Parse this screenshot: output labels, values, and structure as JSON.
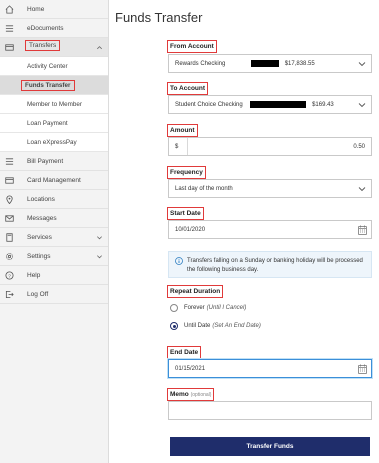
{
  "sidebar": {
    "items": [
      {
        "label": "Home",
        "icon": "home-icon"
      },
      {
        "label": "eDocuments",
        "icon": "menu-lines-icon"
      },
      {
        "label": "Transfers",
        "icon": "transfer-card-icon"
      },
      {
        "label": "Bill Payment",
        "icon": "menu-lines-icon"
      },
      {
        "label": "Card Management",
        "icon": "card-icon"
      },
      {
        "label": "Locations",
        "icon": "location-pin-icon"
      },
      {
        "label": "Messages",
        "icon": "envelope-icon"
      },
      {
        "label": "Services",
        "icon": "calculator-icon"
      },
      {
        "label": "Settings",
        "icon": "gear-icon"
      },
      {
        "label": "Help",
        "icon": "help-icon"
      },
      {
        "label": "Log Off",
        "icon": "logout-icon"
      }
    ],
    "transfers_sub": [
      {
        "label": "Activity Center"
      },
      {
        "label": "Funds Transfer"
      },
      {
        "label": "Member to Member"
      },
      {
        "label": "Loan Payment"
      },
      {
        "label": "Loan eXpressPay"
      }
    ]
  },
  "main": {
    "title": "Funds Transfer",
    "from_account": {
      "label": "From Account",
      "name": "Rewards Checking",
      "balance": "$17,838.55"
    },
    "to_account": {
      "label": "To Account",
      "name": "Student Choice Checking",
      "balance": "$169.43"
    },
    "amount": {
      "label": "Amount",
      "prefix": "$",
      "value": "0.50"
    },
    "frequency": {
      "label": "Frequency",
      "value": "Last day of the month"
    },
    "start_date": {
      "label": "Start Date",
      "value": "10/01/2020"
    },
    "info": "Transfers falling on a Sunday or banking holiday will be processed the following business day.",
    "repeat": {
      "label": "Repeat Duration",
      "forever": {
        "label": "Forever",
        "note": "(Until I Cancel)"
      },
      "until": {
        "label": "Until Date",
        "note": "(Set An End Date)"
      }
    },
    "end_date": {
      "label": "End Date",
      "value": "01/15/2021"
    },
    "memo": {
      "label": "Memo",
      "optional": "(optional)",
      "value": ""
    },
    "submit_label": "Transfer Funds"
  },
  "colors": {
    "accent": "#1f2d6b",
    "highlight": "#e03a3a",
    "info_bg": "#eef5fb"
  }
}
